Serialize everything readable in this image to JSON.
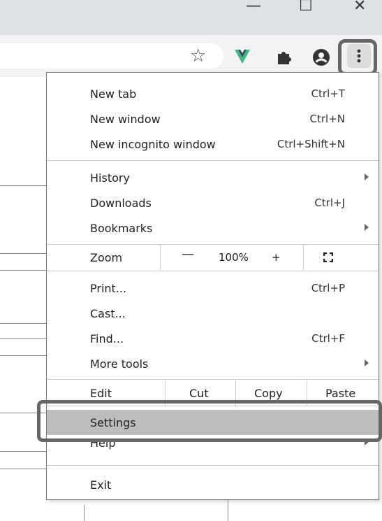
{
  "window": {
    "minimize": "—",
    "maximize": "☐",
    "close": "✕"
  },
  "toolbar": {
    "bookmark_star": "☆",
    "extensions": [
      "vue-devtools",
      "extensions-puzzle",
      "profile"
    ],
    "menu_button": "customize-and-control"
  },
  "menu": {
    "section1": [
      {
        "label": "New tab",
        "shortcut": "Ctrl+T"
      },
      {
        "label": "New window",
        "shortcut": "Ctrl+N"
      },
      {
        "label": "New incognito window",
        "shortcut": "Ctrl+Shift+N"
      }
    ],
    "section2": [
      {
        "label": "History",
        "shortcut": "",
        "submenu": true
      },
      {
        "label": "Downloads",
        "shortcut": "Ctrl+J"
      },
      {
        "label": "Bookmarks",
        "shortcut": "",
        "submenu": true
      }
    ],
    "zoom": {
      "label": "Zoom",
      "minus": "—",
      "value": "100%",
      "plus": "+"
    },
    "section3": [
      {
        "label": "Print...",
        "shortcut": "Ctrl+P"
      },
      {
        "label": "Cast...",
        "shortcut": ""
      },
      {
        "label": "Find...",
        "shortcut": "Ctrl+F"
      },
      {
        "label": "More tools",
        "shortcut": "",
        "submenu": true
      }
    ],
    "edit": {
      "label": "Edit",
      "cut": "Cut",
      "copy": "Copy",
      "paste": "Paste"
    },
    "section4": [
      {
        "label": "Settings",
        "highlighted": true
      },
      {
        "label": "Help",
        "submenu": true
      }
    ],
    "exit": {
      "label": "Exit"
    }
  }
}
